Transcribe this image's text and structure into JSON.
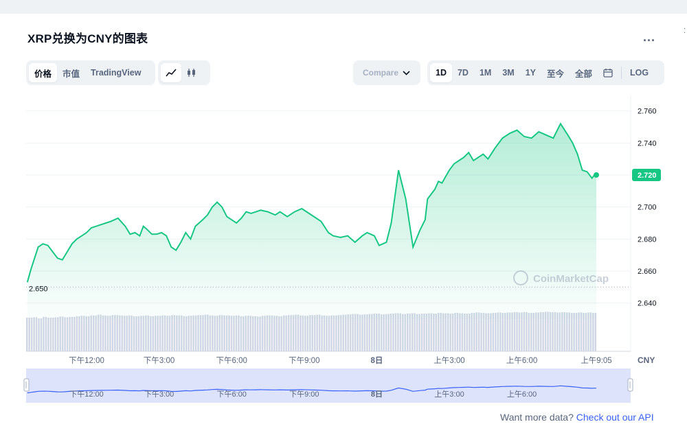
{
  "header": {
    "title": "XRP兑换为CNY的图表",
    "more_label": "..."
  },
  "toolbar": {
    "view_tabs": [
      {
        "label": "价格",
        "active": true
      },
      {
        "label": "市值",
        "active": false
      },
      {
        "label": "TradingView",
        "active": false
      }
    ],
    "chart_type_icons": [
      "line-chart-icon",
      "candlestick-icon"
    ],
    "compare_label": "Compare",
    "ranges": [
      {
        "label": "1D",
        "active": true
      },
      {
        "label": "7D",
        "active": false
      },
      {
        "label": "1M",
        "active": false
      },
      {
        "label": "3M",
        "active": false
      },
      {
        "label": "1Y",
        "active": false
      },
      {
        "label": "至今",
        "active": false
      },
      {
        "label": "全部",
        "active": false
      }
    ],
    "calendar_icon": "calendar-icon",
    "log_label": "LOG"
  },
  "footer": {
    "prompt": "Want more data?",
    "link": "Check out our API"
  },
  "colors": {
    "line": "#16c784",
    "accent_link": "#3861fb",
    "volume": "#cfd6e4",
    "navigator_line": "#3861fb",
    "navigator_fill": "#dde3fb"
  },
  "chart_data": {
    "type": "area",
    "x_unit": "hour",
    "y_unit": "CNY",
    "ylim": [
      2.63,
      2.765
    ],
    "xlim": [
      9.5,
      34.5
    ],
    "y_ticks": [
      "2.640",
      "2.660",
      "2.680",
      "2.700",
      "2.720",
      "2.740",
      "2.760"
    ],
    "x_ticks": [
      {
        "label": "下午12:00",
        "x": 12
      },
      {
        "label": "下午3:00",
        "x": 15
      },
      {
        "label": "下午6:00",
        "x": 18
      },
      {
        "label": "下午9:00",
        "x": 21
      },
      {
        "label": "8日",
        "x": 24
      },
      {
        "label": "上午3:00",
        "x": 27
      },
      {
        "label": "上午6:00",
        "x": 30
      },
      {
        "label": "上午9:05",
        "x": 33.08
      }
    ],
    "start_label": "2.650",
    "current_label": "2.720",
    "axis_unit_label": "CNY",
    "watermark": "CoinMarketCap",
    "grid": true,
    "x": [
      9.55,
      9.7,
      9.85,
      10.0,
      10.2,
      10.4,
      10.6,
      10.8,
      11.0,
      11.2,
      11.4,
      11.6,
      11.8,
      12.0,
      12.2,
      12.4,
      12.6,
      12.8,
      13.0,
      13.3,
      13.6,
      13.8,
      14.0,
      14.2,
      14.35,
      14.5,
      14.7,
      14.9,
      15.1,
      15.3,
      15.5,
      15.7,
      15.9,
      16.1,
      16.3,
      16.5,
      16.8,
      17.0,
      17.2,
      17.4,
      17.6,
      17.8,
      18.0,
      18.2,
      18.4,
      18.6,
      18.8,
      19.0,
      19.2,
      19.5,
      19.8,
      20.0,
      20.3,
      20.6,
      20.9,
      21.2,
      21.5,
      21.7,
      22.0,
      22.2,
      22.5,
      22.8,
      23.1,
      23.4,
      23.6,
      23.9,
      24.1,
      24.4,
      24.6,
      24.9,
      25.2,
      25.5,
      25.8,
      26.0,
      26.1,
      26.25,
      26.4,
      26.55,
      26.7,
      26.85,
      27.0,
      27.2,
      27.4,
      27.6,
      27.8,
      28.0,
      28.2,
      28.4,
      28.6,
      28.9,
      29.2,
      29.5,
      29.8,
      30.1,
      30.4,
      30.7,
      31.0,
      31.3,
      31.6,
      31.9,
      32.1,
      32.3,
      32.5,
      32.7,
      32.9,
      33.0,
      33.08
    ],
    "values": [
      2.653,
      2.661,
      2.668,
      2.675,
      2.677,
      2.676,
      2.672,
      2.668,
      2.667,
      2.672,
      2.677,
      2.68,
      2.682,
      2.684,
      2.687,
      2.688,
      2.689,
      2.69,
      2.691,
      2.693,
      2.688,
      2.683,
      2.684,
      2.682,
      2.688,
      2.686,
      2.683,
      2.683,
      2.684,
      2.682,
      2.675,
      2.673,
      2.678,
      2.684,
      2.68,
      2.688,
      2.692,
      2.695,
      2.7,
      2.703,
      2.7,
      2.694,
      2.692,
      2.69,
      2.693,
      2.697,
      2.696,
      2.697,
      2.698,
      2.697,
      2.695,
      2.697,
      2.694,
      2.697,
      2.699,
      2.696,
      2.693,
      2.691,
      2.684,
      2.682,
      2.681,
      2.682,
      2.678,
      2.682,
      2.684,
      2.682,
      2.676,
      2.678,
      2.69,
      2.723,
      2.705,
      2.675,
      2.686,
      2.692,
      2.705,
      2.708,
      2.711,
      2.716,
      2.715,
      2.719,
      2.723,
      2.727,
      2.729,
      2.731,
      2.734,
      2.729,
      2.731,
      2.733,
      2.73,
      2.737,
      2.743,
      2.746,
      2.748,
      2.744,
      2.743,
      2.747,
      2.745,
      2.743,
      2.752,
      2.745,
      2.74,
      2.733,
      2.723,
      2.722,
      2.718,
      2.72,
      2.72
    ],
    "volume_relative": [
      0.92,
      0.93,
      0.9,
      0.94,
      0.92,
      0.93,
      0.95,
      0.93,
      0.94,
      0.96,
      0.97,
      0.96,
      0.98,
      1.0,
      0.98,
      0.97,
      0.99,
      0.98,
      0.97,
      0.98,
      0.96,
      0.97,
      0.98,
      0.96,
      0.97,
      0.98,
      0.97,
      0.99,
      0.98,
      0.96,
      0.97,
      0.98,
      0.99,
      1.0,
      0.98,
      0.97,
      0.99,
      0.98,
      0.97,
      0.98,
      0.96,
      0.97,
      0.96,
      0.95,
      0.97,
      0.98,
      0.97,
      0.96,
      0.98,
      0.99,
      1.0,
      0.98,
      0.97,
      0.99,
      1.0,
      0.98,
      0.97,
      0.98,
      0.99,
      1.0,
      1.01,
      1.02,
      1.0,
      1.01,
      1.02,
      1.03,
      1.01,
      1.02,
      1.03,
      1.04,
      1.02,
      1.03,
      1.04,
      1.02,
      1.03,
      1.04,
      1.03,
      1.05,
      1.04,
      1.03,
      1.05,
      1.04,
      1.03,
      1.05,
      1.06,
      1.05,
      1.04,
      1.05,
      1.06,
      1.05,
      1.06,
      1.07,
      1.06,
      1.07,
      1.05,
      1.06,
      1.07,
      1.08,
      1.07,
      1.06,
      1.07,
      1.06,
      1.05,
      1.06,
      1.05,
      1.06,
      1.05
    ],
    "navigator": {
      "x_ticks": [
        {
          "label": "下午12:00",
          "x": 12
        },
        {
          "label": "下午3:00",
          "x": 15
        },
        {
          "label": "下午6:00",
          "x": 18
        },
        {
          "label": "下午9:00",
          "x": 21
        },
        {
          "label": "8日",
          "x": 24
        },
        {
          "label": "上午3:00",
          "x": 27
        },
        {
          "label": "上午6:00",
          "x": 30
        }
      ]
    }
  }
}
